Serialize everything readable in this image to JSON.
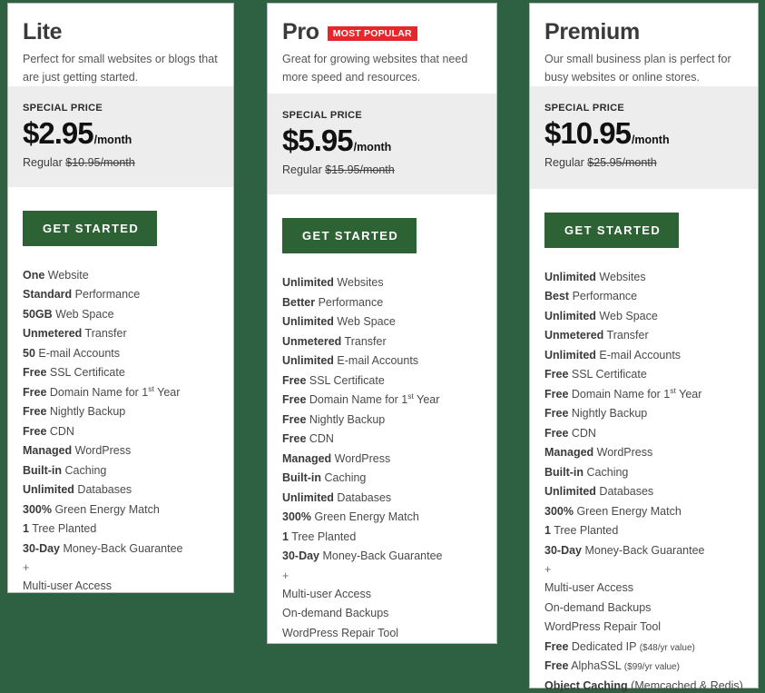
{
  "theme": {
    "page_background": "#2e6141",
    "card_background": "#ffffff",
    "price_band_background": "#ededed",
    "cta_background": "#2d6234",
    "badge_background": "#e8252b"
  },
  "plans": [
    {
      "id": "lite",
      "name": "Lite",
      "badge": null,
      "tagline": "Perfect for small websites or blogs that are just getting started.",
      "special_price_label": "SPECIAL PRICE",
      "price_amount": "$2.95",
      "price_period": "/month",
      "regular_prefix": "Regular",
      "regular_price": "$10.95/month",
      "cta_label": "GET STARTED",
      "features": [
        {
          "strong": "One",
          "rest": " Website"
        },
        {
          "strong": "Standard",
          "rest": " Performance"
        },
        {
          "strong": "50GB",
          "rest": " Web Space"
        },
        {
          "strong": "Unmetered",
          "rest": " Transfer"
        },
        {
          "strong": "50",
          "rest": " E-mail Accounts"
        },
        {
          "strong": "Free",
          "rest": " SSL Certificate"
        },
        {
          "strong": "Free",
          "rest": " Domain Name for 1<sup>st</sup> Year",
          "html": true
        },
        {
          "strong": "Free",
          "rest": " Nightly Backup"
        },
        {
          "strong": "Free",
          "rest": " CDN"
        },
        {
          "strong": "Managed",
          "rest": " WordPress"
        },
        {
          "strong": "Built-in",
          "rest": " Caching"
        },
        {
          "strong": "Unlimited",
          "rest": " Databases"
        },
        {
          "strong": "300%",
          "rest": " Green Energy Match"
        },
        {
          "strong": "1",
          "rest": " Tree Planted"
        },
        {
          "strong": "30-Day",
          "rest": " Money-Back Guarantee"
        },
        {
          "strong": "",
          "rest": "+",
          "separator": true
        },
        {
          "strong": "",
          "rest": "Multi-user Access"
        }
      ]
    },
    {
      "id": "pro",
      "name": "Pro",
      "badge": "MOST POPULAR",
      "tagline": "Great for growing websites that need more speed and resources.",
      "special_price_label": "SPECIAL PRICE",
      "price_amount": "$5.95",
      "price_period": "/month",
      "regular_prefix": "Regular",
      "regular_price": "$15.95/month",
      "cta_label": "GET STARTED",
      "features": [
        {
          "strong": "Unlimited",
          "rest": " Websites"
        },
        {
          "strong": "Better",
          "rest": " Performance"
        },
        {
          "strong": "Unlimited",
          "rest": " Web Space"
        },
        {
          "strong": "Unmetered",
          "rest": " Transfer"
        },
        {
          "strong": "Unlimited",
          "rest": " E-mail Accounts"
        },
        {
          "strong": "Free",
          "rest": " SSL Certificate"
        },
        {
          "strong": "Free",
          "rest": " Domain Name for 1<sup>st</sup> Year",
          "html": true
        },
        {
          "strong": "Free",
          "rest": " Nightly Backup"
        },
        {
          "strong": "Free",
          "rest": " CDN"
        },
        {
          "strong": "Managed",
          "rest": " WordPress"
        },
        {
          "strong": "Built-in",
          "rest": " Caching"
        },
        {
          "strong": "Unlimited",
          "rest": " Databases"
        },
        {
          "strong": "300%",
          "rest": " Green Energy Match"
        },
        {
          "strong": "1",
          "rest": " Tree Planted"
        },
        {
          "strong": "30-Day",
          "rest": " Money-Back Guarantee"
        },
        {
          "strong": "",
          "rest": "+",
          "separator": true
        },
        {
          "strong": "",
          "rest": "Multi-user Access"
        },
        {
          "strong": "",
          "rest": "On-demand Backups"
        },
        {
          "strong": "",
          "rest": "WordPress Repair Tool"
        }
      ]
    },
    {
      "id": "premium",
      "name": "Premium",
      "badge": null,
      "tagline": "Our small business plan is perfect for busy websites or online stores.",
      "special_price_label": "SPECIAL PRICE",
      "price_amount": "$10.95",
      "price_period": "/month",
      "regular_prefix": "Regular",
      "regular_price": "$25.95/month",
      "cta_label": "GET STARTED",
      "features": [
        {
          "strong": "Unlimited",
          "rest": " Websites"
        },
        {
          "strong": "Best",
          "rest": " Performance"
        },
        {
          "strong": "Unlimited",
          "rest": " Web Space"
        },
        {
          "strong": "Unmetered",
          "rest": " Transfer"
        },
        {
          "strong": "Unlimited",
          "rest": " E-mail Accounts"
        },
        {
          "strong": "Free",
          "rest": " SSL Certificate"
        },
        {
          "strong": "Free",
          "rest": " Domain Name for 1<sup>st</sup> Year",
          "html": true
        },
        {
          "strong": "Free",
          "rest": " Nightly Backup"
        },
        {
          "strong": "Free",
          "rest": " CDN"
        },
        {
          "strong": "Managed",
          "rest": " WordPress"
        },
        {
          "strong": "Built-in",
          "rest": " Caching"
        },
        {
          "strong": "Unlimited",
          "rest": " Databases"
        },
        {
          "strong": "300%",
          "rest": " Green Energy Match"
        },
        {
          "strong": "1",
          "rest": " Tree Planted"
        },
        {
          "strong": "30-Day",
          "rest": " Money-Back Guarantee"
        },
        {
          "strong": "",
          "rest": "+",
          "separator": true
        },
        {
          "strong": "",
          "rest": "Multi-user Access"
        },
        {
          "strong": "",
          "rest": "On-demand Backups"
        },
        {
          "strong": "",
          "rest": "WordPress Repair Tool"
        },
        {
          "strong": "Free",
          "rest": " Dedicated IP ",
          "note": "($48/yr value)"
        },
        {
          "strong": "Free",
          "rest": " AlphaSSL ",
          "note": "($99/yr value)"
        },
        {
          "strong": "Object Caching",
          "rest": " (Memcached &amp; Redis)",
          "html": true
        }
      ]
    }
  ]
}
